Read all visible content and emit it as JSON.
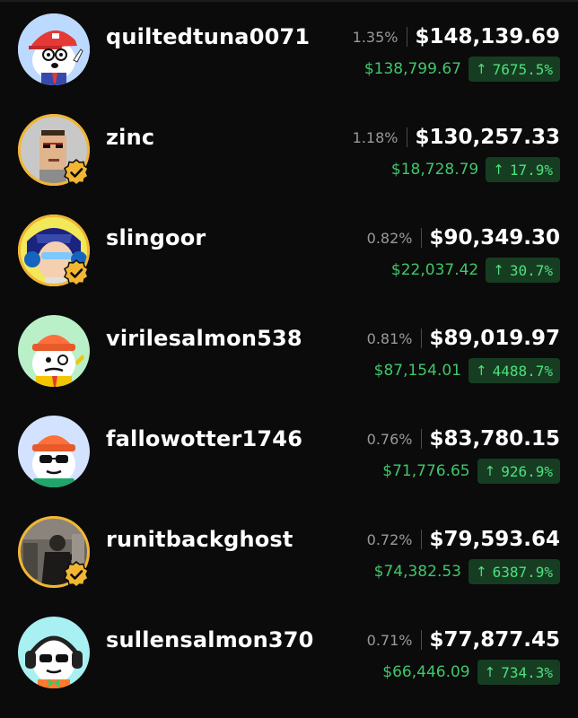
{
  "holders": [
    {
      "username": "quiltedtuna0071",
      "share": "1.35%",
      "value": "$148,139.69",
      "cost": "$138,799.67",
      "gain": "7675.5%",
      "verified": false,
      "avatar_icon": "fish-cartoon-red-cap-icon"
    },
    {
      "username": "zinc",
      "share": "1.18%",
      "value": "$130,257.33",
      "cost": "$18,728.79",
      "gain": "17.9%",
      "verified": true,
      "avatar_icon": "pixel-punk-icon"
    },
    {
      "username": "slingoor",
      "share": "0.82%",
      "value": "$90,349.30",
      "cost": "$22,037.42",
      "gain": "30.7%",
      "verified": true,
      "avatar_icon": "anime-headphones-icon"
    },
    {
      "username": "virilesalmon538",
      "share": "0.81%",
      "value": "$89,019.97",
      "cost": "$87,154.01",
      "gain": "4488.7%",
      "verified": false,
      "avatar_icon": "fish-cartoon-beanie-icon"
    },
    {
      "username": "fallowotter1746",
      "share": "0.76%",
      "value": "$83,780.15",
      "cost": "$71,776.65",
      "gain": "926.9%",
      "verified": false,
      "avatar_icon": "fish-cartoon-sunglasses-icon"
    },
    {
      "username": "runitbackghost",
      "share": "0.72%",
      "value": "$79,593.64",
      "cost": "$74,382.53",
      "gain": "6387.9%",
      "verified": true,
      "avatar_icon": "movie-still-icon"
    },
    {
      "username": "sullensalmon370",
      "share": "0.71%",
      "value": "$77,877.45",
      "cost": "$66,446.09",
      "gain": "734.3%",
      "verified": false,
      "avatar_icon": "fish-cartoon-headphones-icon"
    }
  ],
  "gain_arrow": "↑",
  "colors": {
    "background": "#0b0b0b",
    "cost_green": "#3ec76b",
    "gain_green": "#4ee07d",
    "gain_badge_bg": "#163d22",
    "verified_gold": "#f2b632"
  }
}
